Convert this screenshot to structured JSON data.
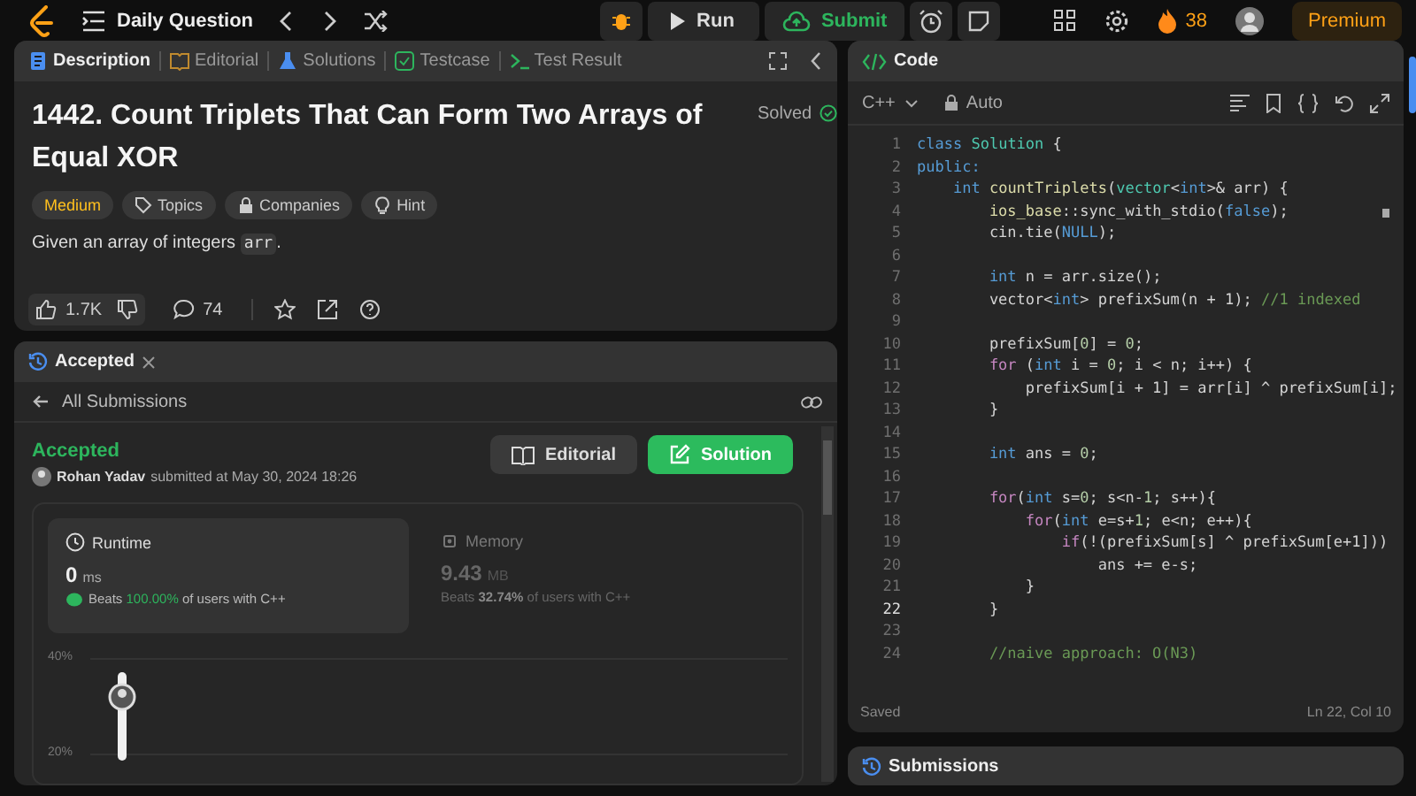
{
  "topbar": {
    "title": "Daily Question",
    "run": "Run",
    "submit": "Submit",
    "streak": "38",
    "premium": "Premium"
  },
  "left_tabs": [
    {
      "label": "Description",
      "selected": true,
      "kind": "doc"
    },
    {
      "label": "Editorial",
      "selected": false,
      "kind": "book"
    },
    {
      "label": "Solutions",
      "selected": false,
      "kind": "flask"
    },
    {
      "label": "Testcase",
      "selected": false,
      "kind": "check"
    },
    {
      "label": "Test Result",
      "selected": false,
      "kind": "term"
    }
  ],
  "problem": {
    "title": "1442. Count Triplets That Can Form Two Arrays of Equal XOR",
    "status": "Solved",
    "tags": [
      {
        "label": "Medium",
        "kind": "difficulty"
      },
      {
        "label": "Topics",
        "kind": "tag"
      },
      {
        "label": "Companies",
        "kind": "lock"
      },
      {
        "label": "Hint",
        "kind": "bulb"
      }
    ],
    "intro": "Given an array of integers",
    "intro_code": "arr",
    "intro_end": ".",
    "likes": "1.7K",
    "comments": "74"
  },
  "result_panel": {
    "tab": "Accepted",
    "back": "All Submissions",
    "status": "Accepted",
    "author": "Rohan Yadav",
    "submitted": "submitted at May 30, 2024 18:26",
    "editorial": "Editorial",
    "solution": "Solution",
    "runtime": {
      "label": "Runtime",
      "value": "0",
      "unit": "ms",
      "beats": "Beats",
      "pct": "100.00%",
      "rest": "of users with C++"
    },
    "memory": {
      "label": "Memory",
      "value": "9.43",
      "unit": "MB",
      "beats": "Beats",
      "pct": "32.74%",
      "rest": "of users with C++"
    },
    "axis_labels": [
      "40%",
      "20%"
    ]
  },
  "code_panel": {
    "title": "Code",
    "language": "C++",
    "mode": "Auto",
    "footer_left": "Saved",
    "footer_right": "Ln 22, Col 10",
    "lines": [
      {
        "num": "1",
        "current": false,
        "tokens": [
          {
            "kind": "kw",
            "text": "class "
          },
          {
            "kind": "type",
            "text": "Solution"
          },
          {
            "kind": "p",
            "text": " {"
          }
        ]
      },
      {
        "num": "2",
        "current": false,
        "tokens": [
          {
            "kind": "kw",
            "text": "public:"
          }
        ]
      },
      {
        "num": "3",
        "current": false,
        "tokens": [
          {
            "kind": "kw",
            "text": "    int "
          },
          {
            "kind": "fn",
            "text": "countTriplets"
          },
          {
            "kind": "p",
            "text": "("
          },
          {
            "kind": "type",
            "text": "vector"
          },
          {
            "kind": "p",
            "text": "<"
          },
          {
            "kind": "kw",
            "text": "int"
          },
          {
            "kind": "p",
            "text": ">& arr) {"
          }
        ]
      },
      {
        "num": "4",
        "current": false,
        "tokens": [
          {
            "kind": "fn",
            "text": "        ios_base"
          },
          {
            "kind": "p",
            "text": "::sync_with_stdio("
          },
          {
            "kind": "kw",
            "text": "false"
          },
          {
            "kind": "p",
            "text": ");"
          }
        ]
      },
      {
        "num": "5",
        "current": false,
        "tokens": [
          {
            "kind": "p",
            "text": "        cin.tie("
          },
          {
            "kind": "kw",
            "text": "NULL"
          },
          {
            "kind": "p",
            "text": ");"
          }
        ]
      },
      {
        "num": "6",
        "current": false
      },
      {
        "num": "7",
        "current": false,
        "tokens": [
          {
            "kind": "kw",
            "text": "        int "
          },
          {
            "kind": "p",
            "text": "n = arr.size();"
          }
        ]
      },
      {
        "num": "8",
        "current": false,
        "tokens": [
          {
            "kind": "p",
            "text": "        vector<"
          },
          {
            "kind": "kw",
            "text": "int"
          },
          {
            "kind": "p",
            "text": "> prefixSum(n + 1); "
          },
          {
            "kind": "cm",
            "text": "//1 indexed"
          }
        ]
      },
      {
        "num": "9",
        "current": false
      },
      {
        "num": "10",
        "current": false,
        "tokens": [
          {
            "kind": "p",
            "text": "        prefixSum["
          },
          {
            "kind": "num",
            "text": "0"
          },
          {
            "kind": "p",
            "text": "] = "
          },
          {
            "kind": "num",
            "text": "0"
          },
          {
            "kind": "p",
            "text": ";"
          }
        ]
      },
      {
        "num": "11",
        "current": false,
        "tokens": [
          {
            "kind": "ctl",
            "text": "        for"
          },
          {
            "kind": "p",
            "text": " ("
          },
          {
            "kind": "kw",
            "text": "int"
          },
          {
            "kind": "p",
            "text": " i = "
          },
          {
            "kind": "num",
            "text": "0"
          },
          {
            "kind": "p",
            "text": "; i < n; i++) {"
          }
        ]
      },
      {
        "num": "12",
        "current": false,
        "tokens": [
          {
            "kind": "p",
            "text": "            prefixSum[i + 1] = arr[i] ^ prefixSum[i];"
          }
        ]
      },
      {
        "num": "13",
        "current": false,
        "tokens": [
          {
            "kind": "p",
            "text": "        }"
          }
        ]
      },
      {
        "num": "14",
        "current": false
      },
      {
        "num": "15",
        "current": false,
        "tokens": [
          {
            "kind": "kw",
            "text": "        int"
          },
          {
            "kind": "p",
            "text": " ans = "
          },
          {
            "kind": "num",
            "text": "0"
          },
          {
            "kind": "p",
            "text": ";"
          }
        ]
      },
      {
        "num": "16",
        "current": false
      },
      {
        "num": "17",
        "current": false,
        "tokens": [
          {
            "kind": "ctl",
            "text": "        for"
          },
          {
            "kind": "p",
            "text": "("
          },
          {
            "kind": "kw",
            "text": "int"
          },
          {
            "kind": "p",
            "text": " s="
          },
          {
            "kind": "num",
            "text": "0"
          },
          {
            "kind": "p",
            "text": "; s<n-"
          },
          {
            "kind": "num",
            "text": "1"
          },
          {
            "kind": "p",
            "text": "; s++){"
          }
        ]
      },
      {
        "num": "18",
        "current": false,
        "tokens": [
          {
            "kind": "ctl",
            "text": "            for"
          },
          {
            "kind": "p",
            "text": "("
          },
          {
            "kind": "kw",
            "text": "int"
          },
          {
            "kind": "p",
            "text": " e=s+"
          },
          {
            "kind": "num",
            "text": "1"
          },
          {
            "kind": "p",
            "text": "; e<n; e++){"
          }
        ]
      },
      {
        "num": "19",
        "current": false,
        "tokens": [
          {
            "kind": "ctl",
            "text": "                if"
          },
          {
            "kind": "p",
            "text": "(!(prefixSum[s] ^ prefixSum[e+1]))"
          }
        ]
      },
      {
        "num": "20",
        "current": false,
        "tokens": [
          {
            "kind": "p",
            "text": "                    ans += e-s;"
          }
        ]
      },
      {
        "num": "21",
        "current": false,
        "tokens": [
          {
            "kind": "p",
            "text": "            }"
          }
        ]
      },
      {
        "num": "22",
        "current": true,
        "tokens": [
          {
            "kind": "p",
            "text": "        }"
          }
        ]
      },
      {
        "num": "23",
        "current": false
      },
      {
        "num": "24",
        "current": false,
        "tokens": [
          {
            "kind": "cm",
            "text": "        //naive approach: O(N3)"
          }
        ]
      }
    ]
  },
  "bottom_tab": {
    "label": "Submissions"
  }
}
